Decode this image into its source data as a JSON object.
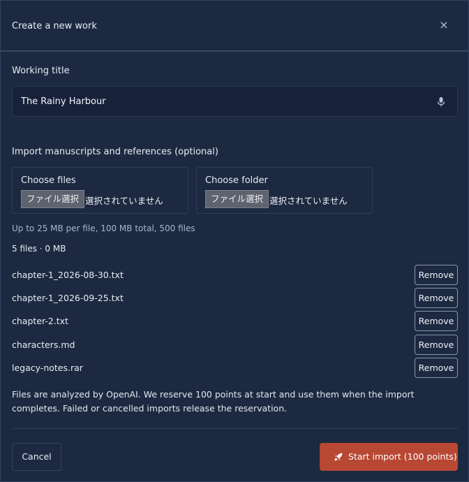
{
  "dialog": {
    "title": "Create a new work",
    "close_icon": "close-icon",
    "close_glyph": "×"
  },
  "working_title": {
    "label": "Working title",
    "value": "The Rainy Harbour",
    "mic_icon": "microphone-icon"
  },
  "import": {
    "label": "Import manuscripts and references (optional)",
    "pickers": [
      {
        "label": "Choose files",
        "button": "ファイル選択",
        "status": "選択されていません"
      },
      {
        "label": "Choose folder",
        "button": "ファイル選択",
        "status": "選択されていません"
      }
    ],
    "limits": "Up to 25 MB per file, 100 MB total, 500 files",
    "summary": "5 files · 0 MB",
    "files": [
      {
        "name": "chapter-1_2026-08-30.txt",
        "action": "Remove"
      },
      {
        "name": "chapter-1_2026-09-25.txt",
        "action": "Remove"
      },
      {
        "name": "chapter-2.txt",
        "action": "Remove"
      },
      {
        "name": "characters.md",
        "action": "Remove"
      },
      {
        "name": "legacy-notes.rar",
        "action": "Remove"
      }
    ],
    "note": "Files are analyzed by OpenAI. We reserve 100 points at start and use them when the import completes. Failed or cancelled imports release the reservation."
  },
  "footer": {
    "cancel_label": "Cancel",
    "start_label": "Start import (100 points)",
    "start_icon": "rocket-icon"
  },
  "colors": {
    "background": "#1d2940",
    "input_bg": "#17213a",
    "primary": "#b84733",
    "border": "#2e3d58"
  }
}
